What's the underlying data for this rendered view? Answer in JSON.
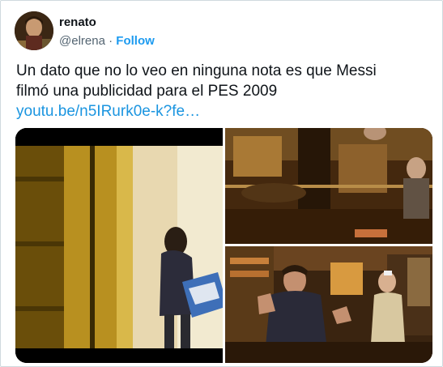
{
  "tweet": {
    "author": {
      "display_name": "renato",
      "handle": "@elrena",
      "separator": "·",
      "follow_label": "Follow"
    },
    "text_line1": "Un dato que no lo veo en ninguna nota es que Messi",
    "text_line2": "filmó una publicidad para el PES 2009",
    "link": "youtu.be/n5IRurk0e-k?fe…",
    "media": {
      "count": 3
    }
  }
}
